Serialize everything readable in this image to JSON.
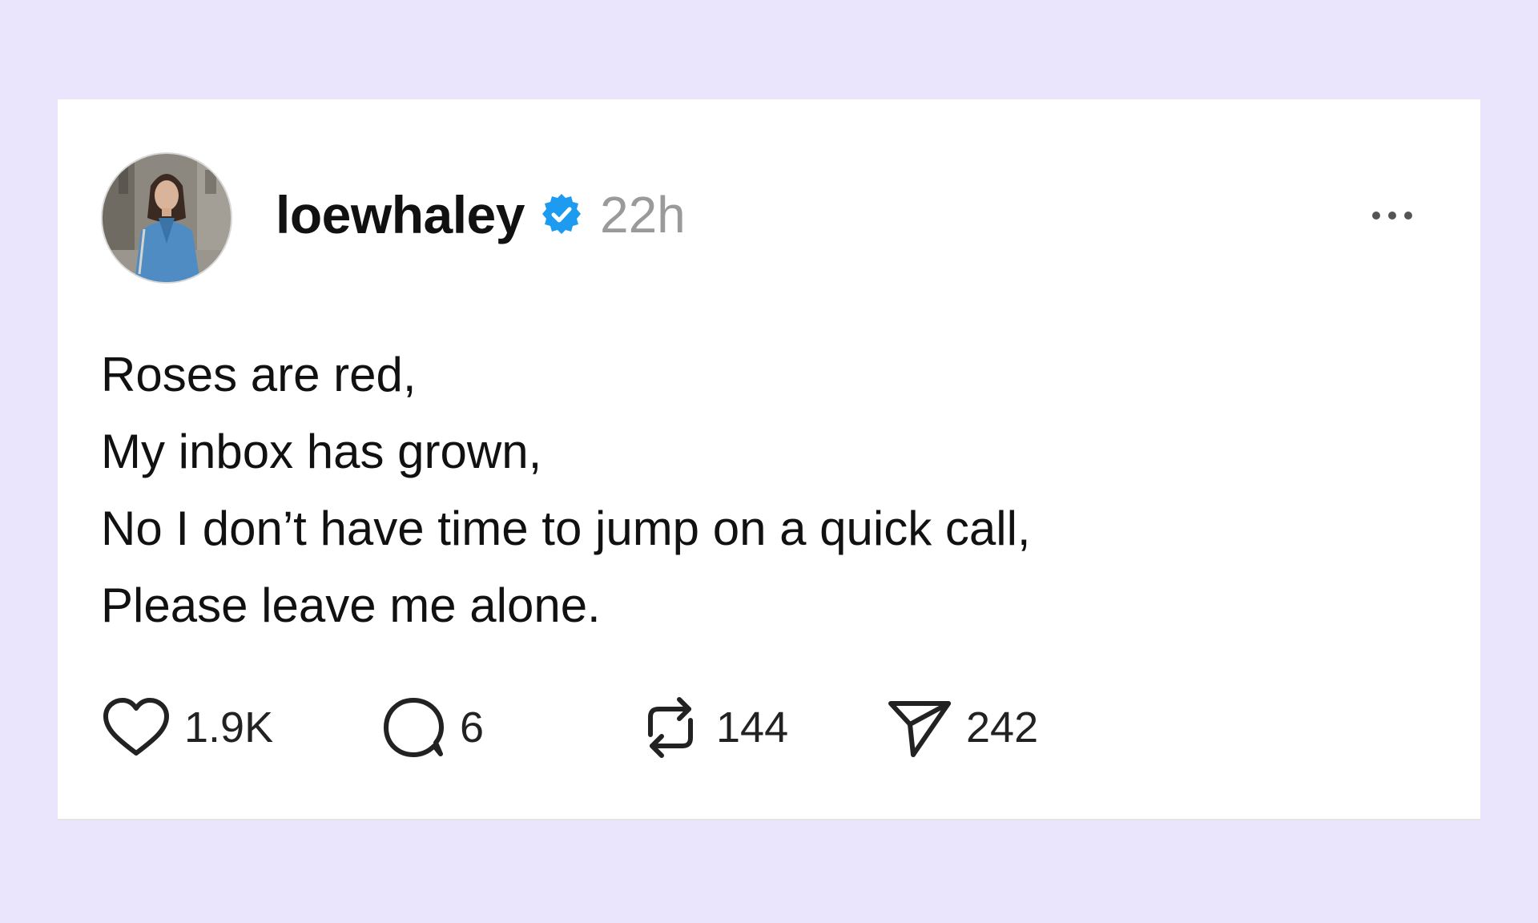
{
  "post": {
    "username": "loewhaley",
    "verified": true,
    "timestamp": "22h",
    "lines": [
      "Roses are red,",
      "My inbox has grown,",
      "No I don’t have time to jump on a quick call,",
      "Please leave me alone."
    ]
  },
  "actions": {
    "likes": "1.9K",
    "replies": "6",
    "reposts": "144",
    "shares": "242"
  },
  "icons": {
    "avatar": "profile-photo",
    "verified": "verified-badge-icon",
    "more": "more-options-icon",
    "like": "heart-icon",
    "reply": "comment-bubble-icon",
    "repost": "repost-icon",
    "share": "send-icon"
  },
  "colors": {
    "background": "#ebe4fd",
    "card": "#ffffff",
    "verified": "#1d9bf0",
    "timestamp": "#9a9a9a",
    "text": "#111111"
  }
}
